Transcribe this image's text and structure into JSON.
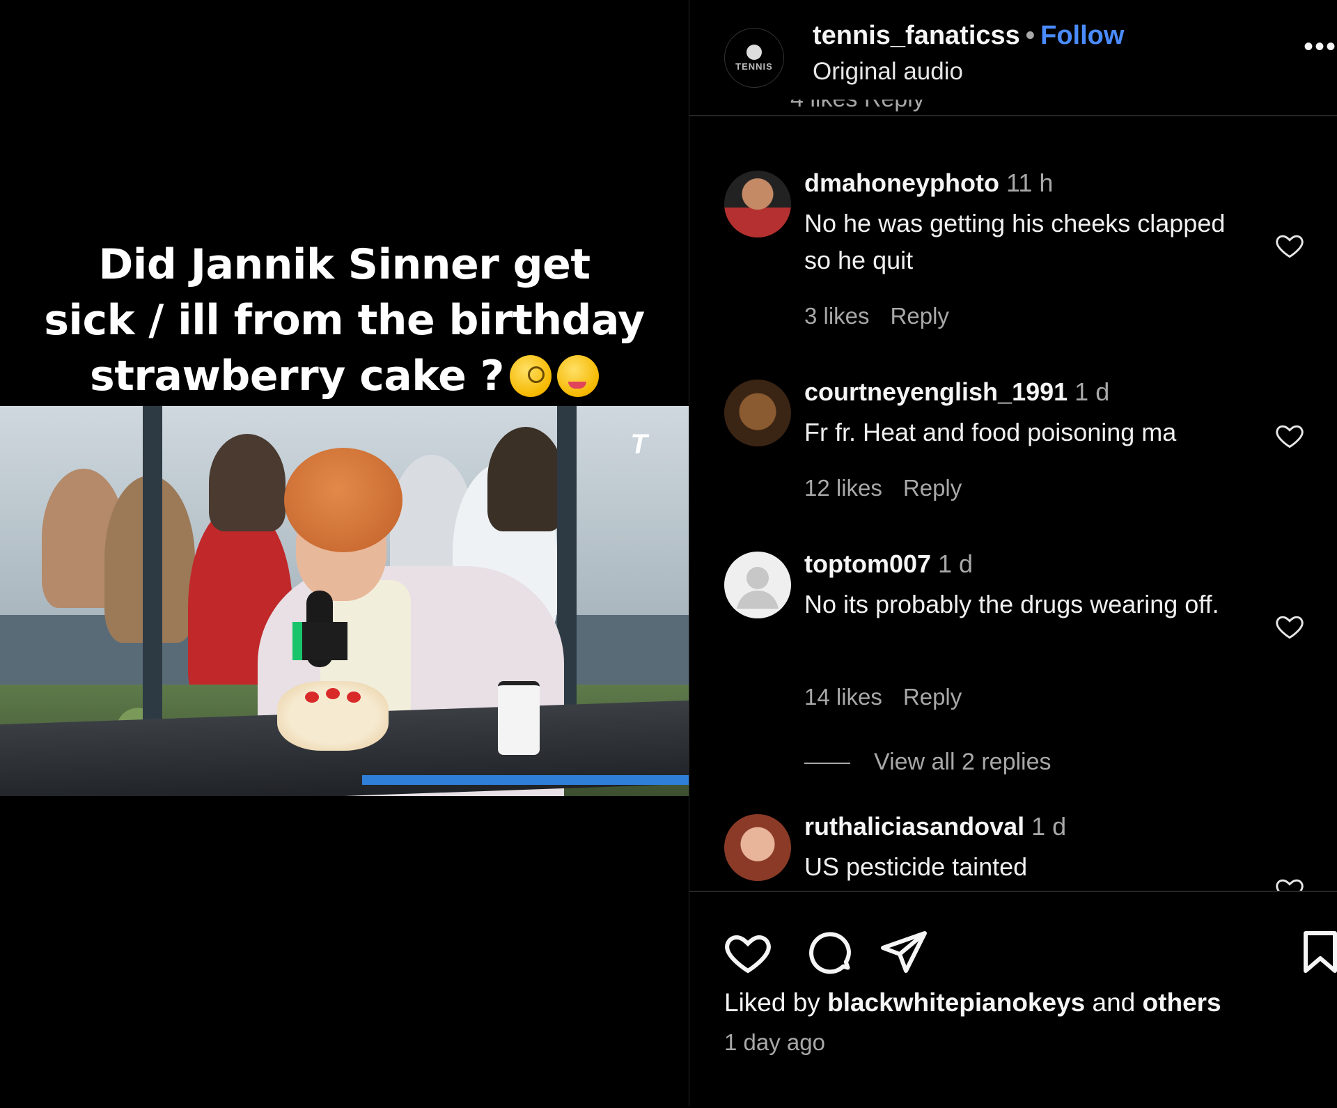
{
  "post": {
    "caption_line1": "Did Jannik Sinner get",
    "caption_line2": "sick / ill from the birthday",
    "caption_line3": "strawberry cake ?",
    "emoji_icons": [
      "face-with-monocle-icon",
      "woozy-face-icon"
    ],
    "video_logo": "T"
  },
  "header": {
    "avatar_text": "TENNIS",
    "username": "tennis_fanaticss",
    "separator": "•",
    "follow_label": "Follow",
    "audio": "Original audio",
    "more_label": "•••",
    "cut_off_text": "4 likes   Reply"
  },
  "comments": [
    {
      "username": "dmahoneyphoto",
      "time": "11 h",
      "text": "No he was getting his cheeks clapped so he quit",
      "likes": "3 likes",
      "reply": "Reply"
    },
    {
      "username": "courtneyenglish_1991",
      "time": "1 d",
      "text": "Fr fr. Heat and food poisoning ma",
      "likes": "12 likes",
      "reply": "Reply"
    },
    {
      "username": "toptom007",
      "time": "1 d",
      "text": "No its probably the drugs wearing off.",
      "likes": "14 likes",
      "reply": "Reply",
      "view_replies": "View all 2 replies"
    },
    {
      "username": "ruthaliciasandoval",
      "time": "1 d",
      "text": "US pesticide tainted"
    }
  ],
  "footer": {
    "liked_prefix": "Liked by",
    "liked_user": "blackwhitepianokeys",
    "liked_and": "and",
    "liked_others": "others",
    "time_ago": "1 day ago"
  },
  "colors": {
    "background": "#000000",
    "follow": "#4a8cff",
    "muted": "#a8a8a8",
    "divider": "#262626"
  }
}
